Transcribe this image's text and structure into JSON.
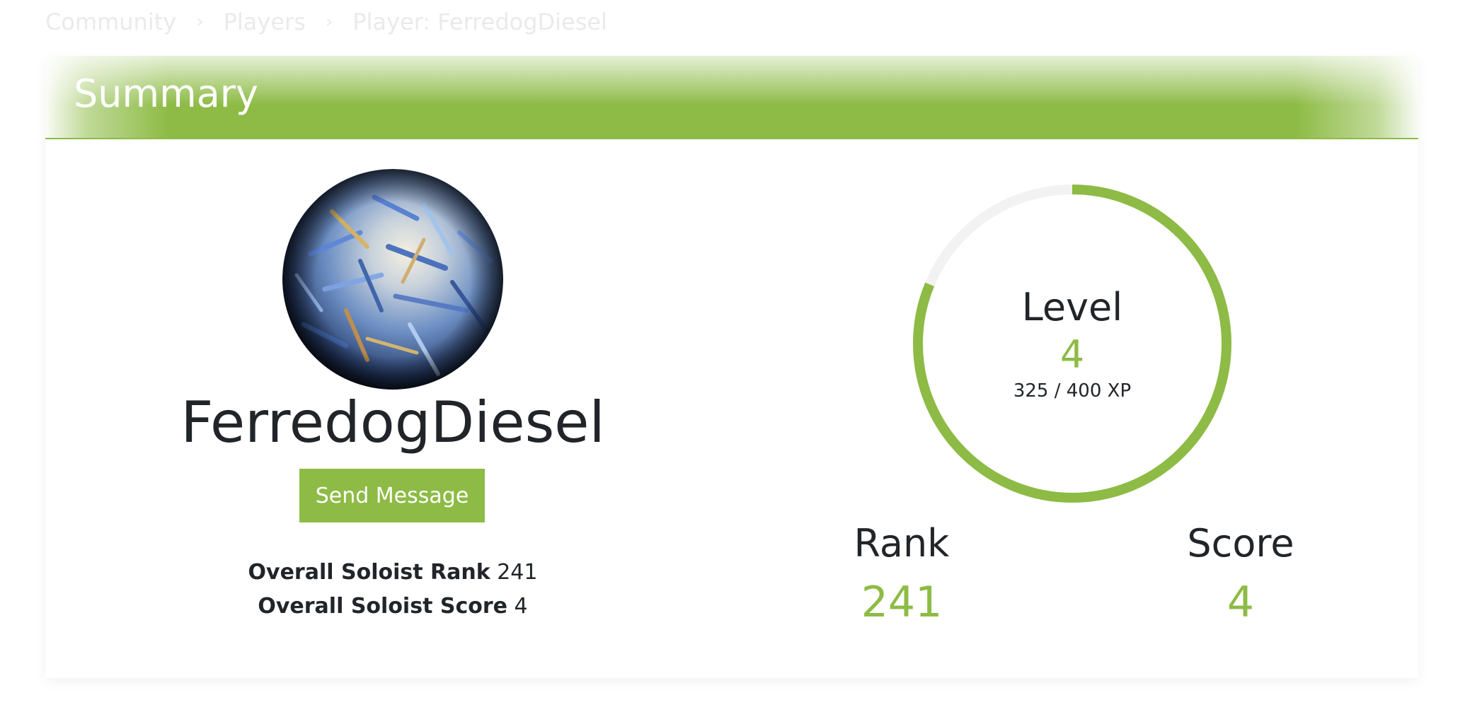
{
  "breadcrumb": {
    "items": [
      "Community",
      "Players",
      "Player: FerredogDiesel"
    ],
    "separator": "›"
  },
  "summary": {
    "title": "Summary",
    "accent_color": "#8dbb45"
  },
  "player": {
    "name": "FerredogDiesel",
    "send_message_label": "Send Message",
    "overall_rank_label": "Overall Soloist Rank",
    "overall_rank_value": "241",
    "overall_score_label": "Overall Soloist Score",
    "overall_score_value": "4"
  },
  "level": {
    "label": "Level",
    "value": "4",
    "xp_text": "325 / 400 XP",
    "xp_current": 325,
    "xp_max": 400
  },
  "rank": {
    "label": "Rank",
    "value": "241"
  },
  "score": {
    "label": "Score",
    "value": "4"
  }
}
